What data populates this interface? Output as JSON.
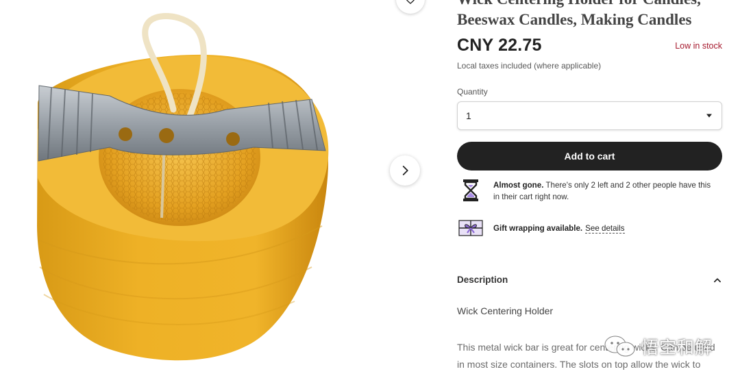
{
  "product": {
    "title": "Wick Centering Holder for Candles,\nBeeswax Candles, Making Candles",
    "price": "CNY 22.75",
    "stock_status": "Low in stock",
    "taxes_note": "Local taxes included (where applicable)"
  },
  "gallery": {
    "favorite_icon": "heart-icon",
    "next_icon": "chevron-right-icon"
  },
  "quantity": {
    "label": "Quantity",
    "selected": "1"
  },
  "cart": {
    "button_label": "Add to cart"
  },
  "notices": {
    "almost_gone": {
      "icon": "hourglass-icon",
      "headline": "Almost gone.",
      "text": " There's only 2 left and 2 other people have this in their cart right now."
    },
    "gift": {
      "icon": "gift-icon",
      "headline": "Gift wrapping available.",
      "link": "See details"
    }
  },
  "description": {
    "heading": "Description",
    "subtitle": "Wick Centering Holder",
    "body": "This metal wick bar is great for centering wicks. Can be used in most size containers. The slots on top allow the wick to slide in and be held firmly in place while"
  },
  "watermark": {
    "text": "悟空和解"
  },
  "colors": {
    "accent_dark": "#222222",
    "stock_red": "#a61a2e",
    "gift_purple": "#8e6bd6"
  }
}
